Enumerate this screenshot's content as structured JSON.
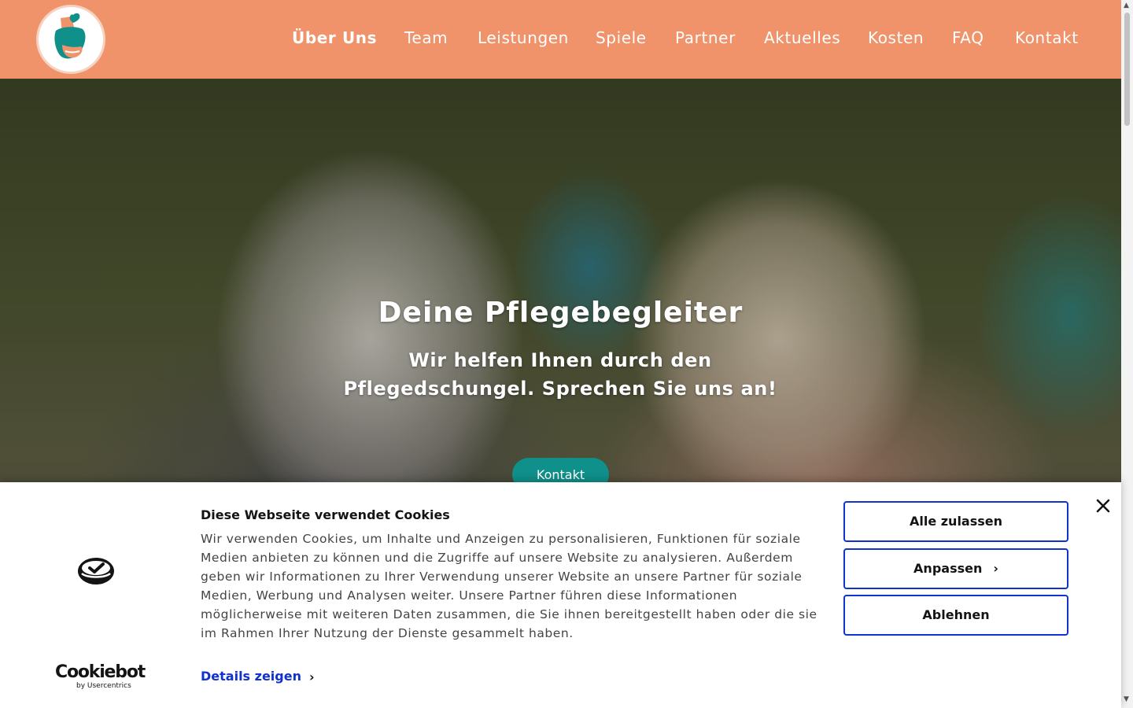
{
  "header": {
    "logo_alt": "Deine Pflegebegleiter Logo",
    "nav": [
      {
        "label": "Über Uns",
        "active": true
      },
      {
        "label": "Team",
        "active": false
      },
      {
        "label": "Leistungen",
        "active": false
      },
      {
        "label": "Spiele",
        "active": false
      },
      {
        "label": "Partner",
        "active": false
      },
      {
        "label": "Aktuelles",
        "active": false
      },
      {
        "label": "Kosten",
        "active": false
      },
      {
        "label": "FAQ",
        "active": false
      },
      {
        "label": "Kontakt",
        "active": false
      }
    ]
  },
  "hero": {
    "title": "Deine Pflegebegleiter",
    "subtitle_line1": "Wir helfen Ihnen durch den",
    "subtitle_line2": "Pflegedschungel. Sprechen Sie uns an!",
    "button_label": "Kontakt"
  },
  "cookie_banner": {
    "brand_main": "Cookiebot",
    "brand_sub": "by Usercentrics",
    "title": "Diese Webseite verwendet Cookies",
    "body": "Wir verwenden Cookies, um Inhalte und Anzeigen zu personalisieren, Funktionen für soziale Medien anbieten zu können und die Zugriffe auf unsere Website zu analysieren. Außerdem geben wir Informationen zu Ihrer Verwendung unserer Website an unsere Partner für soziale Medien, Werbung und Analysen weiter. Unsere Partner führen diese Informationen möglicherweise mit weiteren Daten zusammen, die Sie ihnen bereitgestellt haben oder die sie im Rahmen Ihrer Nutzung der Dienste gesammelt haben.",
    "details_link": "Details zeigen",
    "buttons": {
      "allow_all": "Alle zulassen",
      "customize": "Anpassen",
      "reject": "Ablehnen"
    }
  },
  "colors": {
    "header_bg": "#f0936a",
    "accent_teal": "#10908a",
    "cookie_blue": "#1032cf"
  },
  "icons": {
    "logo": "hands-heart-logo",
    "cookiebot": "cookiebot-mark-icon",
    "close": "close-icon",
    "chevron": "chevron-right-icon"
  }
}
